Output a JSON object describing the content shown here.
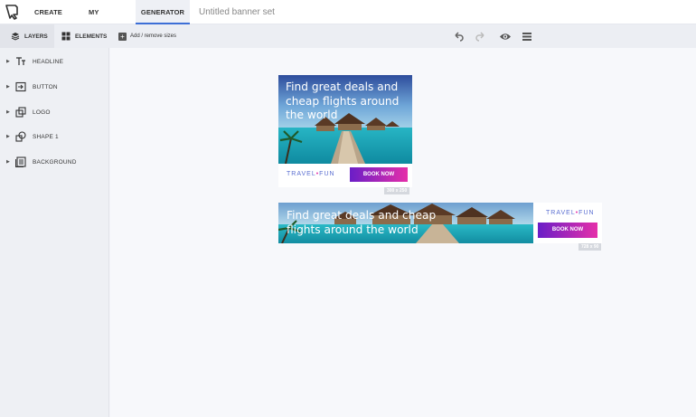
{
  "nav": {
    "tabs": [
      {
        "label": "CREATE NEW"
      },
      {
        "label": "MY BANNERS"
      },
      {
        "label": "GENERATOR"
      }
    ],
    "active_tab": "GENERATOR",
    "banner_set_title": "Untitled banner set"
  },
  "toolbar": {
    "layers_tab": "LAYERS",
    "elements_tab": "ELEMENTS",
    "add_sizes": "Add / remove sizes",
    "icons": [
      "undo-icon",
      "redo-icon",
      "preview-eye-icon",
      "menu-icon"
    ]
  },
  "layers": [
    {
      "label": "HEADLINE",
      "icon": "text-icon"
    },
    {
      "label": "BUTTON",
      "icon": "button-icon"
    },
    {
      "label": "LOGO",
      "icon": "logo-icon"
    },
    {
      "label": "SHAPE 1",
      "icon": "shape-icon"
    },
    {
      "label": "BACKGROUND",
      "icon": "background-icon"
    }
  ],
  "banners": [
    {
      "headline": "Find great deals and cheap flights around the world",
      "brand_left": "TRAVEL",
      "brand_dot": "•",
      "brand_right": "FUN",
      "button": "BOOK NOW",
      "size_label": "300 x 250"
    },
    {
      "headline": "Find great deals and cheap flights around the world",
      "brand_left": "TRAVEL",
      "brand_dot": "•",
      "brand_right": "FUN",
      "button": "BOOK NOW",
      "size_label": "728 x 90"
    }
  ],
  "colors": {
    "accent": "#3d6fd6",
    "button_start": "#6a1ec7",
    "button_end": "#e52fa9",
    "brand": "#5b6fd1",
    "brand_dot": "#e52fa9"
  }
}
